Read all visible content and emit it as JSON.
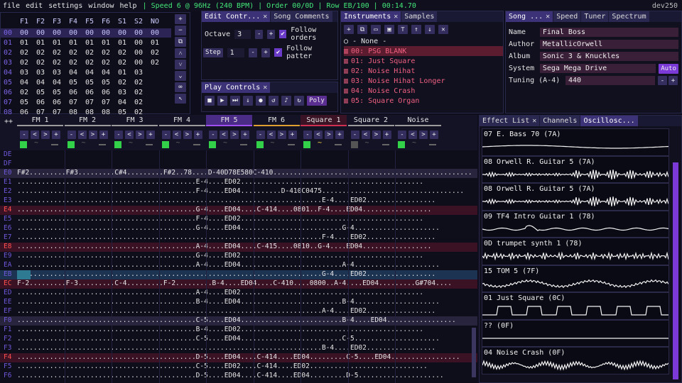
{
  "menu": {
    "file": "file",
    "edit": "edit",
    "settings": "settings",
    "window": "window",
    "help": "help",
    "status": "| Speed 6 @ 96Hz (240 BPM) | Order 00/0D | Row EB/100 | 00:14.70",
    "version": "dev250"
  },
  "orders": {
    "headers": [
      "F1",
      "F2",
      "F3",
      "F4",
      "F5",
      "F6",
      "S1",
      "S2",
      "NO"
    ],
    "rows": [
      [
        "00",
        "00",
        "00",
        "00",
        "00",
        "00",
        "00",
        "00",
        "00",
        "00"
      ],
      [
        "01",
        "01",
        "01",
        "01",
        "01",
        "01",
        "01",
        "01",
        "00",
        "01"
      ],
      [
        "02",
        "02",
        "02",
        "02",
        "02",
        "02",
        "02",
        "02",
        "00",
        "02"
      ],
      [
        "03",
        "02",
        "02",
        "02",
        "02",
        "02",
        "02",
        "02",
        "00",
        "02"
      ],
      [
        "04",
        "03",
        "03",
        "03",
        "04",
        "04",
        "04",
        "01",
        "03"
      ],
      [
        "05",
        "04",
        "04",
        "04",
        "05",
        "05",
        "05",
        "02",
        "02"
      ],
      [
        "06",
        "02",
        "05",
        "05",
        "06",
        "06",
        "06",
        "03",
        "02"
      ],
      [
        "07",
        "05",
        "06",
        "06",
        "07",
        "07",
        "07",
        "04",
        "02"
      ],
      [
        "08",
        "06",
        "07",
        "07",
        "08",
        "08",
        "08",
        "05",
        "02"
      ]
    ]
  },
  "edit_controls": {
    "tab1": "Edit Contr...",
    "tab2": "Song Comments",
    "octave_label": "Octave",
    "octave_value": "3",
    "step_label": "Step",
    "step_value": "1",
    "follow_orders": "Follow orders",
    "follow_pattern": "Follow patter"
  },
  "play_controls": {
    "title": "Play Controls",
    "poly": "Poly"
  },
  "instruments": {
    "tab1": "Instruments",
    "tab2": "Samples",
    "none": "- None -",
    "items": [
      "00: PSG BLANK",
      "01: Just Square",
      "02: Noise Hihat",
      "03: Noise Hihat Longer",
      "04: Noise Crash",
      "05: Square Organ"
    ]
  },
  "song_info": {
    "tabs": [
      "Song ...",
      "Speed",
      "Tuner",
      "Spectrum"
    ],
    "name_label": "Name",
    "name": "Final Boss",
    "author_label": "Author",
    "author": "MetallicOrwell",
    "album_label": "Album",
    "album": "Sonic 3 & Knuckles",
    "system_label": "System",
    "system": "Sega Mega Drive",
    "auto": "Auto",
    "tuning_label": "Tuning (A-4)",
    "tuning": "440"
  },
  "channels": [
    "FM 1",
    "FM 2",
    "FM 3",
    "FM 4",
    "FM 5",
    "FM 6",
    "Square 1",
    "Square 2",
    "Noise"
  ],
  "pattern": {
    "row_labels": [
      "DE",
      "DF",
      "E0",
      "E1",
      "E2",
      "E3",
      "E4",
      "E5",
      "E6",
      "E7",
      "E8",
      "E9",
      "EA",
      "EB",
      "EC",
      "ED",
      "EE",
      "EF",
      "F0",
      "F1",
      "F2",
      "F3",
      "F4",
      "F5",
      "F6"
    ],
    "text": [
      "F#2.........F#3.........C#4.........F#2..78....D-40D78E580C-410...................................................G#704....",
      "............................................E-4....ED02.............................................",
      "............................................F-4....ED04..........D-410C0475...................................",
      "...........................................................................E-4....ED02.................",
      "............................................G-4....ED04....C-414....0801..F-4....ED04.................",
      "............................................F-4....ED02.............................................",
      "............................................G-4....ED04.........................G-4.....................",
      "...........................................................................F-4....ED02.................",
      "............................................A-4....ED04....C-415....0810..G-4....ED04.................",
      "............................................G-4....ED02.............................................",
      "............................................A-4....ED04.........................A-4.....................",
      "...........................................................................G-4....ED02.................",
      "F-2.........F-3.........C-4.........F-2.........B-4....ED04....C-410....0800..A-4....ED04.........G#704....",
      "............................................A-4....ED02.............................................",
      "............................................B-4....ED04.........................B-4.....................",
      "...........................................................................A-4....ED02.................",
      "............................................C-5....ED04.........................B-4....ED04.................",
      "............................................B-4....ED02.............................................",
      "............................................C-5....ED04.........................C-5.....................",
      "...........................................................................B-4....ED02.................",
      "............................................D-5....ED04....C-414....ED04.........C-5....ED04.................",
      "............................................C-5....ED02....C-414....ED02.............................",
      "............................................D-5....ED04....C-414....ED04.........D-5....................."
    ]
  },
  "effect_tabs": [
    "Effect List",
    "Channels",
    "Oscillosc..."
  ],
  "oscilloscope": [
    "07 E. Bass 70 (7A)",
    "08 Orwell R. Guitar 5 (7A)",
    "08 Orwell R. Guitar 5 (7A)",
    "09 TF4 Intro Guitar 1 (78)",
    "0D trumpet synth 1 (78)",
    "15 TOM 5 (7F)",
    "01 Just Square (0C)",
    "??  (0F)",
    "04 Noise Crash (0F)"
  ],
  "colors": {
    "accent": "#6b3cc8",
    "status": "#44e878",
    "note": "#e6e6e6",
    "ins": "#4a9cff",
    "vol": "#44e878",
    "fx": "#a050f0"
  }
}
